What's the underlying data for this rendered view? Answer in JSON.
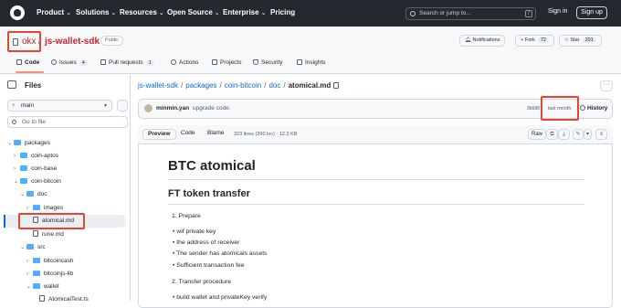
{
  "topnav": {
    "items": [
      "Product",
      "Solutions",
      "Resources",
      "Open Source",
      "Enterprise",
      "Pricing"
    ],
    "search_placeholder": "Search or jump to...",
    "search_key": "/",
    "sign_in": "Sign in",
    "sign_up": "Sign up"
  },
  "repo": {
    "owner": "okx",
    "separator": "/",
    "name": "js-wallet-sdk",
    "visibility": "Public",
    "notifications": "Notifications",
    "fork_label": "Fork",
    "fork_count": "72",
    "star_label": "Star",
    "star_count": "201"
  },
  "tabs": [
    {
      "label": "Code",
      "count": ""
    },
    {
      "label": "Issues",
      "count": "4"
    },
    {
      "label": "Pull requests",
      "count": "1"
    },
    {
      "label": "Actions",
      "count": ""
    },
    {
      "label": "Projects",
      "count": ""
    },
    {
      "label": "Security",
      "count": ""
    },
    {
      "label": "Insights",
      "count": ""
    }
  ],
  "sidebar": {
    "title": "Files",
    "branch": "main",
    "goto_placeholder": "Go to file",
    "tree": [
      {
        "label": "packages",
        "type": "folder",
        "open": true
      },
      {
        "label": "coin-aptos",
        "type": "folder",
        "open": false
      },
      {
        "label": "coin-base",
        "type": "folder",
        "open": false
      },
      {
        "label": "coin-bitcoin",
        "type": "folder",
        "open": true
      },
      {
        "label": "doc",
        "type": "folder",
        "open": true
      },
      {
        "label": "images",
        "type": "folder",
        "open": false
      },
      {
        "label": "atomical.md",
        "type": "file",
        "selected": true
      },
      {
        "label": "rune.md",
        "type": "file"
      },
      {
        "label": "src",
        "type": "folder",
        "open": true
      },
      {
        "label": "bitcoincash",
        "type": "folder",
        "open": false
      },
      {
        "label": "bitcoinjs-lib",
        "type": "folder",
        "open": false
      },
      {
        "label": "wallet",
        "type": "folder",
        "open": true
      },
      {
        "label": "AtomicalTest.ts",
        "type": "file"
      }
    ]
  },
  "breadcrumb": {
    "parts": [
      "js-wallet-sdk",
      "packages",
      "coin-bitcoin",
      "doc"
    ],
    "current": "atomical.md",
    "more": "···"
  },
  "commit": {
    "author": "minmin.yan",
    "message": "upgrade code.",
    "hash": "3b688",
    "dot": "·",
    "time": "last month",
    "history": "History"
  },
  "file": {
    "tab_preview": "Preview",
    "tab_code": "Code",
    "tab_blame": "Blame",
    "info": "323 lines (290 loc) · 12.3 KB",
    "raw": "Raw"
  },
  "markdown": {
    "h1": "BTC atomical",
    "h2": "FT token transfer",
    "items": [
      "1. Prepare",
      "wif private key",
      "the address of receiver",
      "The sender has atomicals assets",
      "Sufficient transaction fee",
      "2. Transfer procedure",
      "build wallet and privateKey verify"
    ]
  },
  "colors": {
    "header_bg": "#24292f",
    "accent_link": "#0969da",
    "annotation_red": "#e5462f",
    "folder_blue": "#54aeff"
  }
}
